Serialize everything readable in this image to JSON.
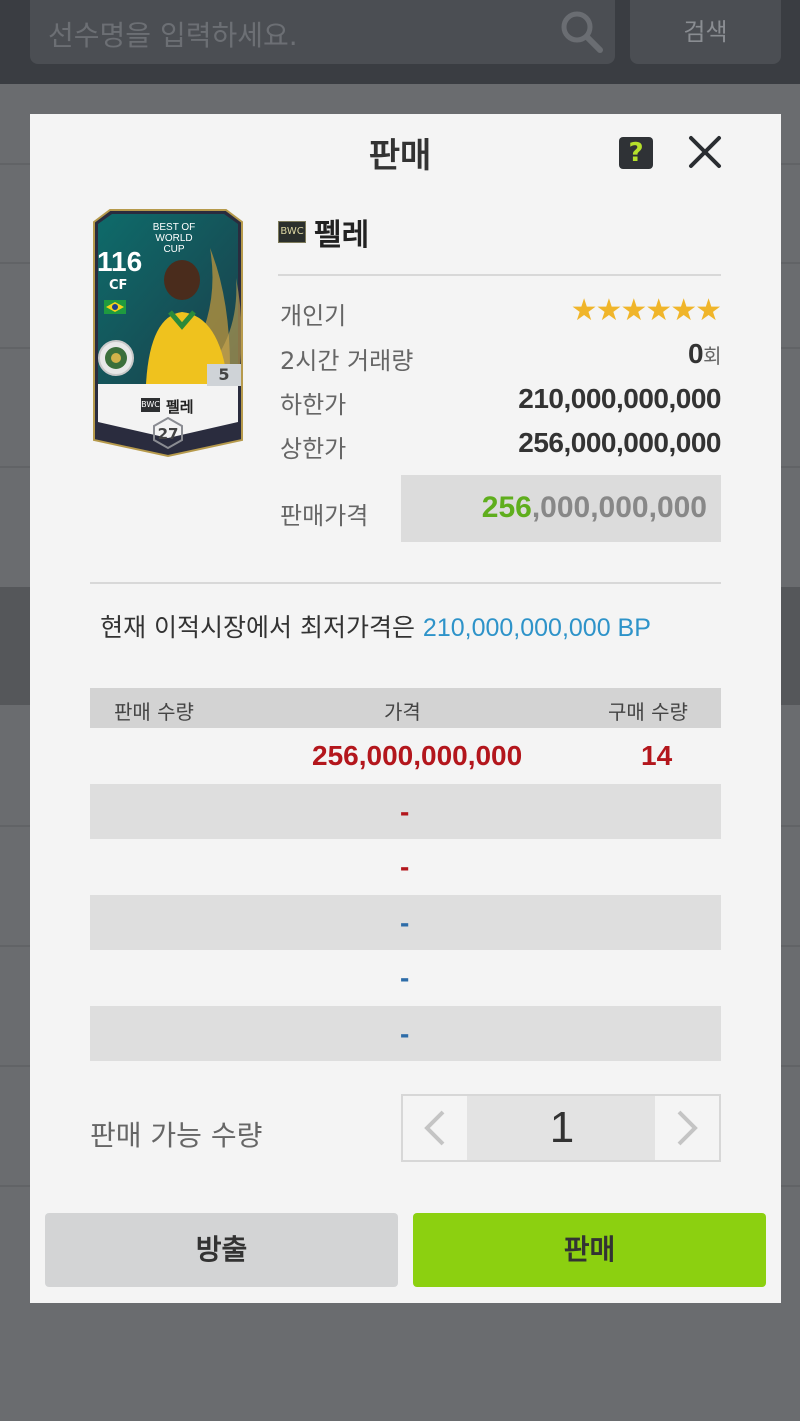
{
  "background": {
    "search_placeholder": "선수명을 입력하세요.",
    "search_button": "검색"
  },
  "modal": {
    "title": "판매",
    "help_label": "?"
  },
  "card": {
    "ovr": "116",
    "position": "CF",
    "badge_text": "BEST OF WORLD CUP",
    "level": "5",
    "season_tag": "BWC",
    "name": "펠레",
    "grade": "27"
  },
  "player": {
    "season_tag": "BWC",
    "name": "펠레",
    "rows": [
      {
        "label": "개인기",
        "value": "★★★★★★"
      },
      {
        "label": "2시간 거래량",
        "value": "0",
        "unit": "회"
      },
      {
        "label": "하한가",
        "value": "210,000,000,000"
      },
      {
        "label": "상한가",
        "value": "256,000,000,000"
      }
    ],
    "sale_price_label": "판매가격",
    "sale_price_highlight": "256",
    "sale_price_rest": ",000,000,000"
  },
  "lowest": {
    "prefix": "현재 이적시장에서 최저가격은 ",
    "value": "210,000,000,000",
    "suffix": " BP"
  },
  "table": {
    "headers": [
      "판매 수량",
      "가격",
      "구매 수량"
    ],
    "rows": [
      {
        "sell_qty": "",
        "price": "256,000,000,000",
        "buy_qty": "14"
      },
      {
        "sell_qty": "",
        "price": "-",
        "buy_qty": ""
      },
      {
        "sell_qty": "",
        "price": "-",
        "buy_qty": ""
      },
      {
        "sell_qty": "",
        "price": "-",
        "buy_qty": ""
      },
      {
        "sell_qty": "",
        "price": "-",
        "buy_qty": ""
      },
      {
        "sell_qty": "",
        "price": "-",
        "buy_qty": ""
      }
    ]
  },
  "quantity": {
    "label": "판매 가능 수량",
    "value": "1"
  },
  "buttons": {
    "release": "방출",
    "sell": "판매"
  },
  "colors": {
    "accent_green": "#8cd010",
    "price_red": "#b3161c",
    "price_blue": "#2d6ca8",
    "lowest_blue": "#2e93c9",
    "star": "#f0b52a"
  }
}
